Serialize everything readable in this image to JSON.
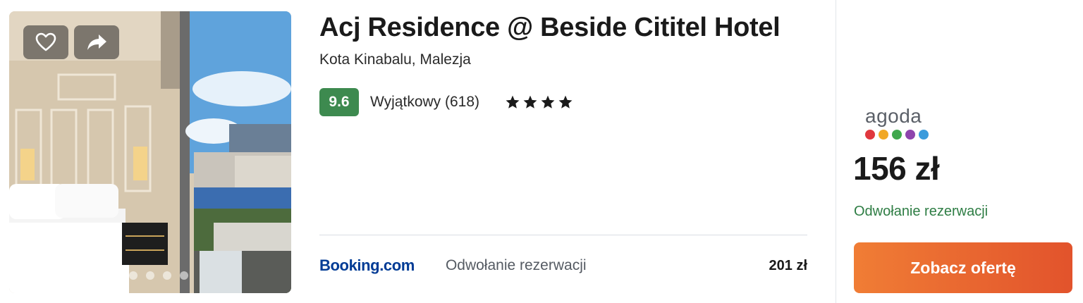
{
  "hotel": {
    "name": "Acj Residence @ Beside Cititel Hotel",
    "location": "Kota Kinabalu, Malezja",
    "score": "9.6",
    "rating_label": "Wyjątkowy (618)",
    "stars": 4
  },
  "photo": {
    "favorite_icon": "heart-icon",
    "share_icon": "share-arrow-icon",
    "dot_count": 5,
    "active_dot": 1
  },
  "secondary_offer": {
    "provider_name": "Booking",
    "provider_suffix": ".com",
    "cancellation": "Odwołanie rezerwacji",
    "price": "201 zł",
    "brand_color": "#003b95"
  },
  "main_offer": {
    "provider": "agoda",
    "provider_dot_colors": [
      "#e0383e",
      "#f1a826",
      "#3fa84d",
      "#8e44ad",
      "#3b9bdc"
    ],
    "price": "156 zł",
    "cancellation": "Odwołanie rezerwacji",
    "cta_label": "Zobacz ofertę"
  },
  "colors": {
    "score_badge": "#3d8a4f",
    "cancellation_green": "#2e7d44",
    "cta_start": "#f07d35",
    "cta_end": "#e2532c"
  }
}
